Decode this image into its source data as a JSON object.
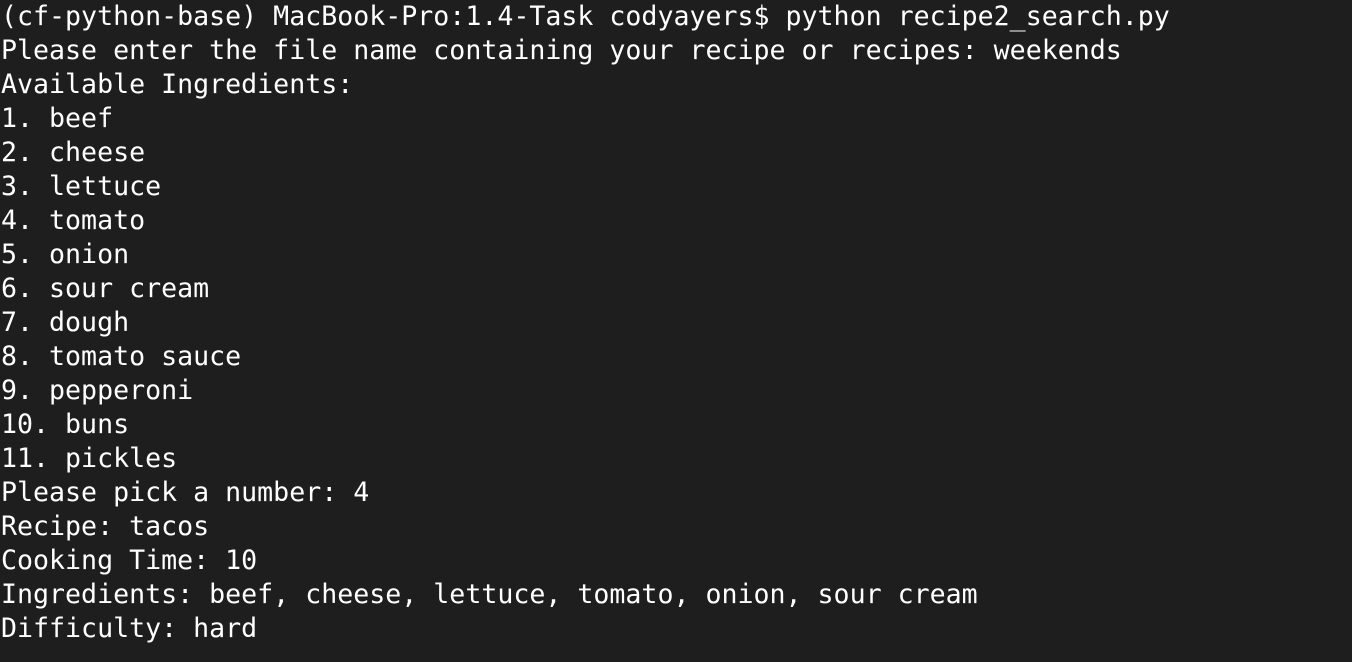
{
  "terminal": {
    "background": "#1e1e1e",
    "text_color": "#ffffff",
    "lines": [
      "(cf-python-base) MacBook-Pro:1.4-Task codyayers$ python recipe2_search.py",
      "Please enter the file name containing your recipe or recipes: weekends",
      "Available Ingredients:",
      "1. beef",
      "2. cheese",
      "3. lettuce",
      "4. tomato",
      "5. onion",
      "6. sour cream",
      "7. dough",
      "8. tomato sauce",
      "9. pepperoni",
      "10. buns",
      "11. pickles",
      "Please pick a number: 4",
      "Recipe: tacos",
      "Cooking Time: 10",
      "Ingredients: beef, cheese, lettuce, tomato, onion, sour cream",
      "Difficulty: hard"
    ]
  }
}
